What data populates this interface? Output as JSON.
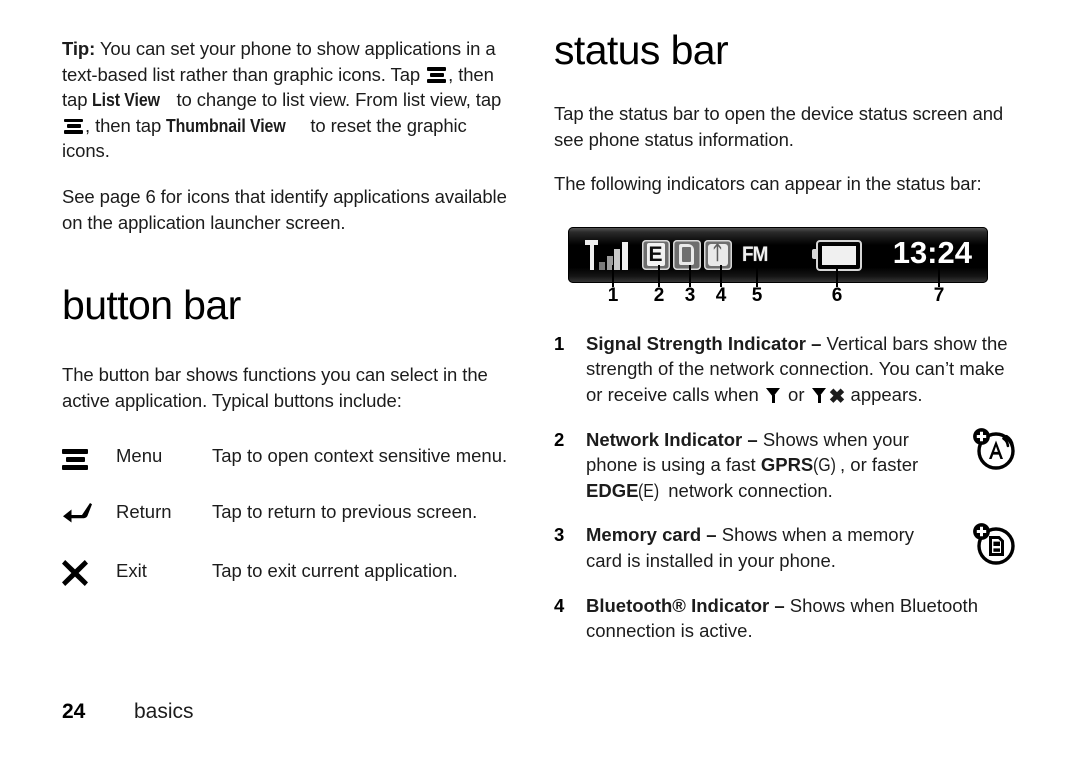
{
  "document": {
    "footer": {
      "page_number": "24",
      "section": "basics"
    }
  },
  "left_column": {
    "tip": {
      "label": "Tip:",
      "part1": " You can set your phone to show applications in a text-based list rather than graphic icons. Tap ",
      "part2": ", then tap ",
      "bold1": "List View",
      "part3": " to change to list view. From list view, tap ",
      "part4": ", then tap ",
      "bold2": "Thumbnail View",
      "part5": " to reset the graphic icons."
    },
    "see_page": "See page 6 for icons that identify applications available on the application launcher screen.",
    "heading": "button bar",
    "intro": "The button bar shows functions you can select in the active application. Typical buttons include:",
    "buttons": [
      {
        "icon": "menu-icon",
        "label": "Menu",
        "description": "Tap to open context sensitive menu."
      },
      {
        "icon": "return-icon",
        "label": "Return",
        "description": "Tap to return to previous screen."
      },
      {
        "icon": "exit-icon",
        "label": "Exit",
        "description": "Tap to exit current application."
      }
    ]
  },
  "right_column": {
    "heading": "status bar",
    "intro1": "Tap the status bar to open the device status screen and see phone status information.",
    "intro2": "The following indicators can appear in the status bar:",
    "status_bar": {
      "clock": "13:24",
      "network_letter": "E",
      "fm_label": "FM",
      "icons": [
        "signal-strength-icon",
        "network-edge-icon",
        "memory-card-icon",
        "bluetooth-icon",
        "fm-radio-icon",
        "battery-icon",
        "clock"
      ],
      "callouts": [
        "1",
        "2",
        "3",
        "4",
        "5",
        "6",
        "7"
      ]
    },
    "indicators": [
      {
        "number": "1",
        "title": "Signal Strength Indicator",
        "dash": " – ",
        "text_a": "Vertical bars show the strength of the network connection. You can’t make or receive calls when ",
        "text_b": " or ",
        "text_c": " appears.",
        "margin_icon": ""
      },
      {
        "number": "2",
        "title": "Network Indicator",
        "dash": " – ",
        "text_a": "Shows when your phone is using a fast ",
        "bold_gprs": "GPRS",
        "paren_g": " (G)",
        "text_b": ", or faster ",
        "bold_edge": "EDGE",
        "paren_e": " (E)",
        "text_c": " network connection.",
        "margin_icon": "network-plus-icon"
      },
      {
        "number": "3",
        "title": "Memory card",
        "dash": " – ",
        "text_a": "Shows when a memory card is installed in your phone.",
        "margin_icon": "memory-card-plus-icon"
      },
      {
        "number": "4",
        "title": "Bluetooth® Indicator",
        "dash": " – ",
        "text_a": "Shows when Bluetooth connection is active.",
        "margin_icon": ""
      }
    ]
  },
  "colors": {
    "text": "#1c1c1c",
    "heading": "#000000",
    "statusbar_bg": "#000000",
    "statusbar_icon": "#f0f0f0",
    "page_bg": "#ffffff"
  }
}
